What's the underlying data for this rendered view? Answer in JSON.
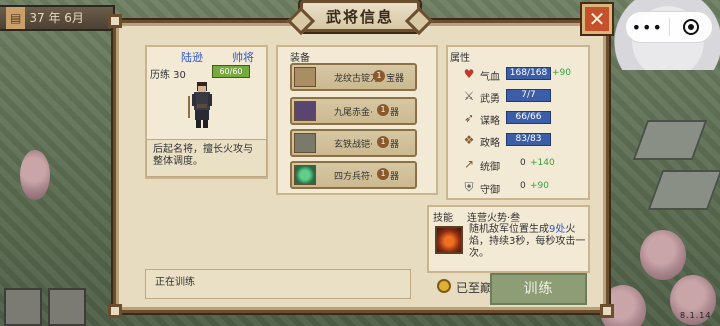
{
  "top_bar": {
    "date_badge": "37",
    "date_text": "年 6月"
  },
  "wechat": {
    "more": "•••"
  },
  "dialog": {
    "title": "武将信息"
  },
  "general": {
    "name": "陆逊",
    "class": "帅将",
    "exp_label": "历练 30",
    "exp_value": "60/60",
    "exp_fraction": 1.0,
    "description": "后起名将，擅长火攻与整体调度。"
  },
  "equipment": {
    "title": "装备",
    "items": [
      {
        "name": "龙纹古锭刀",
        "grade": "1",
        "grade_label": "宝器"
      },
      {
        "name": "九尾赤金·",
        "grade": "1",
        "grade_label": "器"
      },
      {
        "name": "玄铁战铠·",
        "grade": "1",
        "grade_label": "器"
      },
      {
        "name": "四方兵符·",
        "grade": "1",
        "grade_label": "器"
      }
    ]
  },
  "attributes": {
    "title": "属性",
    "rows": [
      {
        "label": "气血",
        "value": "168/168",
        "bonus": "+90",
        "icon": "heart-icon"
      },
      {
        "label": "武勇",
        "value": "7/7",
        "bonus": "",
        "icon": "swords-icon"
      },
      {
        "label": "谋略",
        "value": "66/66",
        "bonus": "",
        "icon": "bow-icon"
      },
      {
        "label": "政略",
        "value": "83/83",
        "bonus": "",
        "icon": "scroll-icon"
      },
      {
        "label": "统御",
        "value": "0",
        "bonus": "+140",
        "icon": "spear-icon"
      },
      {
        "label": "守御",
        "value": "0",
        "bonus": "+90",
        "icon": "shield-icon"
      }
    ]
  },
  "skill": {
    "label": "技能",
    "name": "连营火势·叁",
    "desc_prefix": "随机敌军位置生成",
    "desc_highlight": "9处",
    "desc_suffix": "火焰，持续3秒，每秒攻击一次。"
  },
  "status": {
    "text": "正在训练"
  },
  "training": {
    "radio_label": "已至巅峰",
    "button": "训练"
  },
  "version": "8.1.14"
}
